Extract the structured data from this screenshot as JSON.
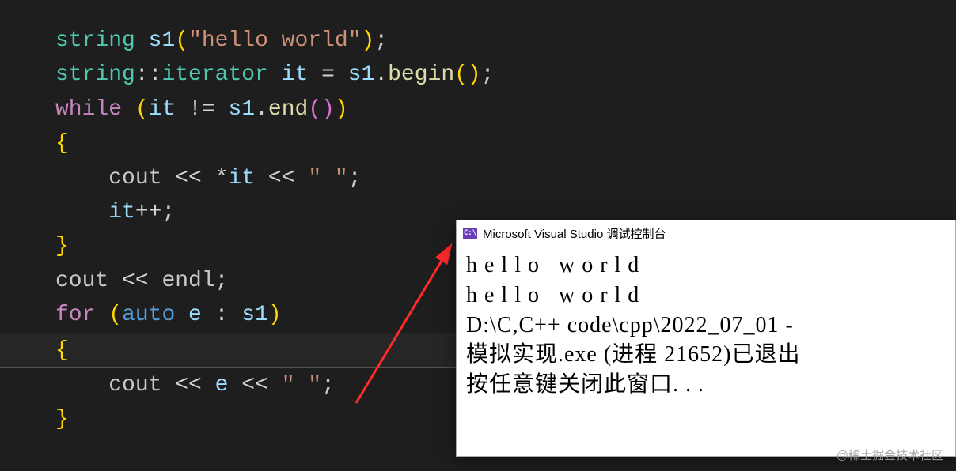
{
  "code": {
    "l1_type": "string",
    "l1_obj": " s1",
    "l1_p1": "(",
    "l1_str": "\"hello world\"",
    "l1_p2": ")",
    "l1_semi": ";",
    "l2_ns": "string",
    "l2_scope": "::",
    "l2_iter": "iterator",
    "l2_obj": " it ",
    "l2_eq": "= ",
    "l2_s1": "s1",
    "l2_dot": ".",
    "l2_fn": "begin",
    "l2_pr": "()",
    "l2_semi": ";",
    "l3_while": "while ",
    "l3_p1": "(",
    "l3_it": "it ",
    "l3_ne": "!= ",
    "l3_s1": "s1",
    "l3_dot": ".",
    "l3_fn": "end",
    "l3_pr": "()",
    "l3_p2": ")",
    "l4_brace": "{",
    "l5_pad": "    ",
    "l5_cout": "cout ",
    "l5_ll1": "<< ",
    "l5_star": "*",
    "l5_it": "it ",
    "l5_ll2": "<< ",
    "l5_str": "\" \"",
    "l5_semi": ";",
    "l6_pad": "    ",
    "l6_it": "it",
    "l6_pp": "++",
    "l6_semi": ";",
    "l7_brace": "}",
    "l8_cout": "cout ",
    "l8_ll": "<< ",
    "l8_endl": "endl",
    "l8_semi": ";",
    "l9_for": "for ",
    "l9_p1": "(",
    "l9_auto": "auto ",
    "l9_e": "e ",
    "l9_colon": ": ",
    "l9_s1": "s1",
    "l9_p2": ")",
    "l10_brace": "{",
    "l11_pad": "    ",
    "l11_cout": "cout ",
    "l11_ll1": "<< ",
    "l11_e": "e ",
    "l11_ll2": "<< ",
    "l11_str": "\" \"",
    "l11_semi": ";",
    "l12_brace": "}"
  },
  "console": {
    "icon": "C:\\",
    "title": "Microsoft Visual Studio 调试控制台",
    "out1": "h e l l o   w o r l d",
    "out2": "h e l l o   w o r l d",
    "out3": "D:\\C,C++ code\\cpp\\2022_07_01 -",
    "out4": "模拟实现.exe (进程 21652)已退出",
    "out5": "按任意键关闭此窗口. . ."
  },
  "watermark": "@稀土掘金技术社区"
}
